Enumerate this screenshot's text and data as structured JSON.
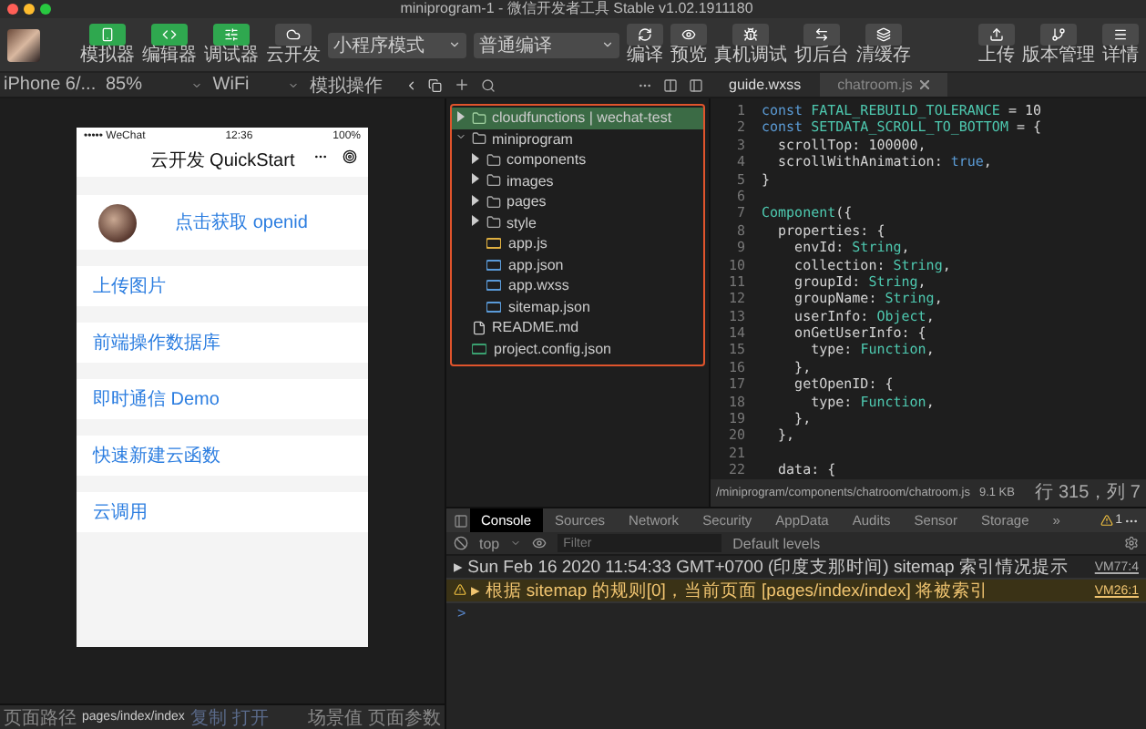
{
  "window": {
    "title": "miniprogram-1 - 微信开发者工具 Stable v1.02.1911180"
  },
  "toolbar": {
    "mode_buttons": [
      {
        "label": "模拟器",
        "selected": true
      },
      {
        "label": "编辑器",
        "selected": true
      },
      {
        "label": "调试器",
        "selected": true
      },
      {
        "label": "云开发",
        "selected": false
      }
    ],
    "mode_select": "小程序模式",
    "compile_select": "普通编译",
    "actions": [
      {
        "label": "编译",
        "kind": "refresh"
      },
      {
        "label": "预览",
        "kind": "eye"
      },
      {
        "label": "真机调试",
        "kind": "bug"
      },
      {
        "label": "切后台",
        "kind": "switch"
      },
      {
        "label": "清缓存",
        "kind": "layers"
      }
    ],
    "right_actions": [
      {
        "label": "上传",
        "kind": "upload"
      },
      {
        "label": "版本管理",
        "kind": "branch"
      },
      {
        "label": "详情",
        "kind": "list"
      }
    ]
  },
  "simulator": {
    "device": "iPhone 6/...",
    "zoom": "85%",
    "network": "WiFi",
    "operation": "模拟操作",
    "phone": {
      "carrier": "••••• WeChat",
      "time": "12:36",
      "battery": "100%",
      "nav_title": "云开发 QuickStart",
      "openid_button": "点击获取 openid",
      "menu": [
        "上传图片",
        "前端操作数据库",
        "即时通信 Demo",
        "快速新建云函数",
        "云调用"
      ]
    }
  },
  "file_tree": {
    "items": [
      {
        "label": "cloudfunctions | wechat-test",
        "kind": "cloud-folder",
        "selected": true,
        "expanded": false
      },
      {
        "label": "miniprogram",
        "kind": "folder",
        "selected": false,
        "expanded": true,
        "children": [
          {
            "label": "components",
            "kind": "folder",
            "selected": false,
            "expanded": false
          },
          {
            "label": "images",
            "kind": "folder",
            "selected": false,
            "expanded": false
          },
          {
            "label": "pages",
            "kind": "folder",
            "selected": false,
            "expanded": false
          },
          {
            "label": "style",
            "kind": "folder",
            "selected": false,
            "expanded": false
          },
          {
            "label": "app.js",
            "kind": "js",
            "selected": false
          },
          {
            "label": "app.json",
            "kind": "json",
            "selected": false
          },
          {
            "label": "app.wxss",
            "kind": "wxss",
            "selected": false
          },
          {
            "label": "sitemap.json",
            "kind": "json",
            "selected": false
          }
        ]
      },
      {
        "label": "README.md",
        "kind": "md",
        "selected": false
      },
      {
        "label": "project.config.json",
        "kind": "config",
        "selected": false
      }
    ]
  },
  "editor": {
    "tabs": [
      {
        "label": "guide.wxss",
        "selected": false,
        "closable": false
      },
      {
        "label": "chatroom.js",
        "selected": true,
        "closable": true
      }
    ],
    "lines": [
      {
        "number": "1",
        "tokens": [
          {
            "text": "const",
            "kind": "keyword"
          },
          {
            "text": " FATAL_REBUILD_TOLERANCE ",
            "kind": "constant"
          },
          {
            "text": "= 10",
            "kind": "plain"
          }
        ]
      },
      {
        "number": "2",
        "tokens": [
          {
            "text": "const",
            "kind": "keyword"
          },
          {
            "text": " SETDATA_SCROLL_TO_BOTTOM ",
            "kind": "constant"
          },
          {
            "text": "= {",
            "kind": "plain"
          }
        ]
      },
      {
        "number": "3",
        "tokens": [
          {
            "text": "  scrollTop: 100000,",
            "kind": "plain"
          }
        ]
      },
      {
        "number": "4",
        "tokens": [
          {
            "text": "  scrollWithAnimation: ",
            "kind": "plain"
          },
          {
            "text": "true",
            "kind": "keyword"
          },
          {
            "text": ",",
            "kind": "plain"
          }
        ]
      },
      {
        "number": "5",
        "tokens": [
          {
            "text": "}",
            "kind": "plain"
          }
        ]
      },
      {
        "number": "6"
      },
      {
        "number": "7",
        "tokens": [
          {
            "text": "Component",
            "kind": "type"
          },
          {
            "text": "({",
            "kind": "plain"
          }
        ]
      },
      {
        "number": "8",
        "tokens": [
          {
            "text": "  properties: {",
            "kind": "plain"
          }
        ]
      },
      {
        "number": "9",
        "tokens": [
          {
            "text": "    envId: ",
            "kind": "plain"
          },
          {
            "text": "String",
            "kind": "type"
          },
          {
            "text": ",",
            "kind": "plain"
          }
        ]
      },
      {
        "number": "10",
        "tokens": [
          {
            "text": "    collection: ",
            "kind": "plain"
          },
          {
            "text": "String",
            "kind": "type"
          },
          {
            "text": ",",
            "kind": "plain"
          }
        ]
      },
      {
        "number": "11",
        "tokens": [
          {
            "text": "    groupId: ",
            "kind": "plain"
          },
          {
            "text": "String",
            "kind": "type"
          },
          {
            "text": ",",
            "kind": "plain"
          }
        ]
      },
      {
        "number": "12",
        "tokens": [
          {
            "text": "    groupName: ",
            "kind": "plain"
          },
          {
            "text": "String",
            "kind": "type"
          },
          {
            "text": ",",
            "kind": "plain"
          }
        ]
      },
      {
        "number": "13",
        "tokens": [
          {
            "text": "    userInfo: ",
            "kind": "plain"
          },
          {
            "text": "Object",
            "kind": "type"
          },
          {
            "text": ",",
            "kind": "plain"
          }
        ]
      },
      {
        "number": "14",
        "tokens": [
          {
            "text": "    onGetUserInfo: {",
            "kind": "plain"
          }
        ]
      },
      {
        "number": "15",
        "tokens": [
          {
            "text": "      type: ",
            "kind": "plain"
          },
          {
            "text": "Function",
            "kind": "type"
          },
          {
            "text": ",",
            "kind": "plain"
          }
        ]
      },
      {
        "number": "16",
        "tokens": [
          {
            "text": "    },",
            "kind": "plain"
          }
        ]
      },
      {
        "number": "17",
        "tokens": [
          {
            "text": "    getOpenID: {",
            "kind": "plain"
          }
        ]
      },
      {
        "number": "18",
        "tokens": [
          {
            "text": "      type: ",
            "kind": "plain"
          },
          {
            "text": "Function",
            "kind": "type"
          },
          {
            "text": ",",
            "kind": "plain"
          }
        ]
      },
      {
        "number": "19",
        "tokens": [
          {
            "text": "    },",
            "kind": "plain"
          }
        ]
      },
      {
        "number": "20",
        "tokens": [
          {
            "text": "  },",
            "kind": "plain"
          }
        ]
      },
      {
        "number": "21"
      },
      {
        "number": "22",
        "tokens": [
          {
            "text": "  data: {",
            "kind": "plain"
          }
        ]
      }
    ],
    "file_path": "/miniprogram/components/chatroom/chatroom.js",
    "file_size": "9.1 KB",
    "cursor": "行 315，列 7"
  },
  "console": {
    "tabs": [
      {
        "label": "Console",
        "selected": true
      },
      {
        "label": "Sources",
        "selected": false
      },
      {
        "label": "Network",
        "selected": false
      },
      {
        "label": "Security",
        "selected": false
      },
      {
        "label": "AppData",
        "selected": false
      },
      {
        "label": "Audits",
        "selected": false
      },
      {
        "label": "Sensor",
        "selected": false
      },
      {
        "label": "Storage",
        "selected": false
      },
      {
        "label": "»",
        "selected": false
      }
    ],
    "warning_count": "1",
    "context": "top",
    "filter_placeholder": "Filter",
    "levels": "Default levels",
    "messages": [
      {
        "kind": "info",
        "text": "▸ Sun Feb 16 2020 11:54:33 GMT+0700 (印度支那时间) sitemap 索引情况提示",
        "source": "VM77:4"
      },
      {
        "kind": "warning",
        "text": "▸ 根据 sitemap 的规则[0]，当前页面 [pages/index/index] 将被索引",
        "source": "VM26:1"
      }
    ],
    "prompt": ">"
  },
  "status_bar": {
    "path_label": "页面路径",
    "path": "pages/index/index",
    "links": [
      "复制",
      "打开"
    ],
    "right": [
      "场景值",
      "页面参数"
    ]
  }
}
